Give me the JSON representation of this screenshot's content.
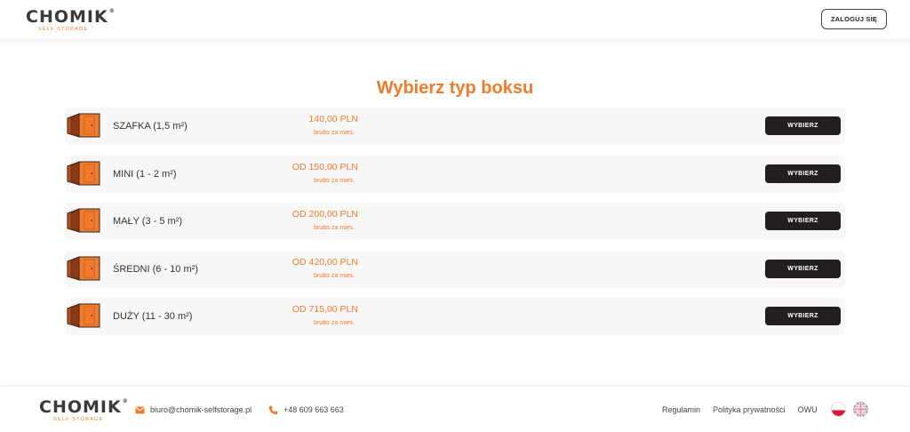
{
  "header": {
    "logo_text": "CHOMIK",
    "logo_reg": "®",
    "logo_sub": "SELF STORAGE",
    "login_label": "ZALOGUJ SIĘ"
  },
  "main": {
    "title": "Wybierz typ boksu",
    "price_note": "brutto za mies.",
    "select_label": "WYBIERZ",
    "boxes": [
      {
        "name": "SZAFKA (1,5 m²)",
        "price": "140,00 PLN"
      },
      {
        "name": "MINI (1 - 2 m²)",
        "price": "OD 150,00 PLN"
      },
      {
        "name": "MAŁY (3 - 5 m²)",
        "price": "OD 200,00 PLN"
      },
      {
        "name": "ŚREDNI (6 - 10 m²)",
        "price": "OD 420,00 PLN"
      },
      {
        "name": "DUŻY (11 - 30 m²)",
        "price": "OD 715,00 PLN"
      }
    ]
  },
  "footer": {
    "logo_text": "CHOMIK",
    "logo_reg": "®",
    "logo_sub": "SELF STORAGE",
    "email": "biuro@chomik-selfstorage.pl",
    "phone": "+48 609 663 663",
    "links": [
      "Regulamin",
      "Polityka prywatności",
      "OWU"
    ]
  },
  "icons": {
    "box": "storage-box-icon",
    "email": "envelope-icon",
    "phone": "phone-icon",
    "flag_pl": "flag-poland-icon",
    "flag_en": "flag-uk-icon"
  },
  "colors": {
    "accent": "#f07b2c",
    "button_dark": "#231f20",
    "text": "#333333",
    "row_bg": "#f7f7f7"
  }
}
